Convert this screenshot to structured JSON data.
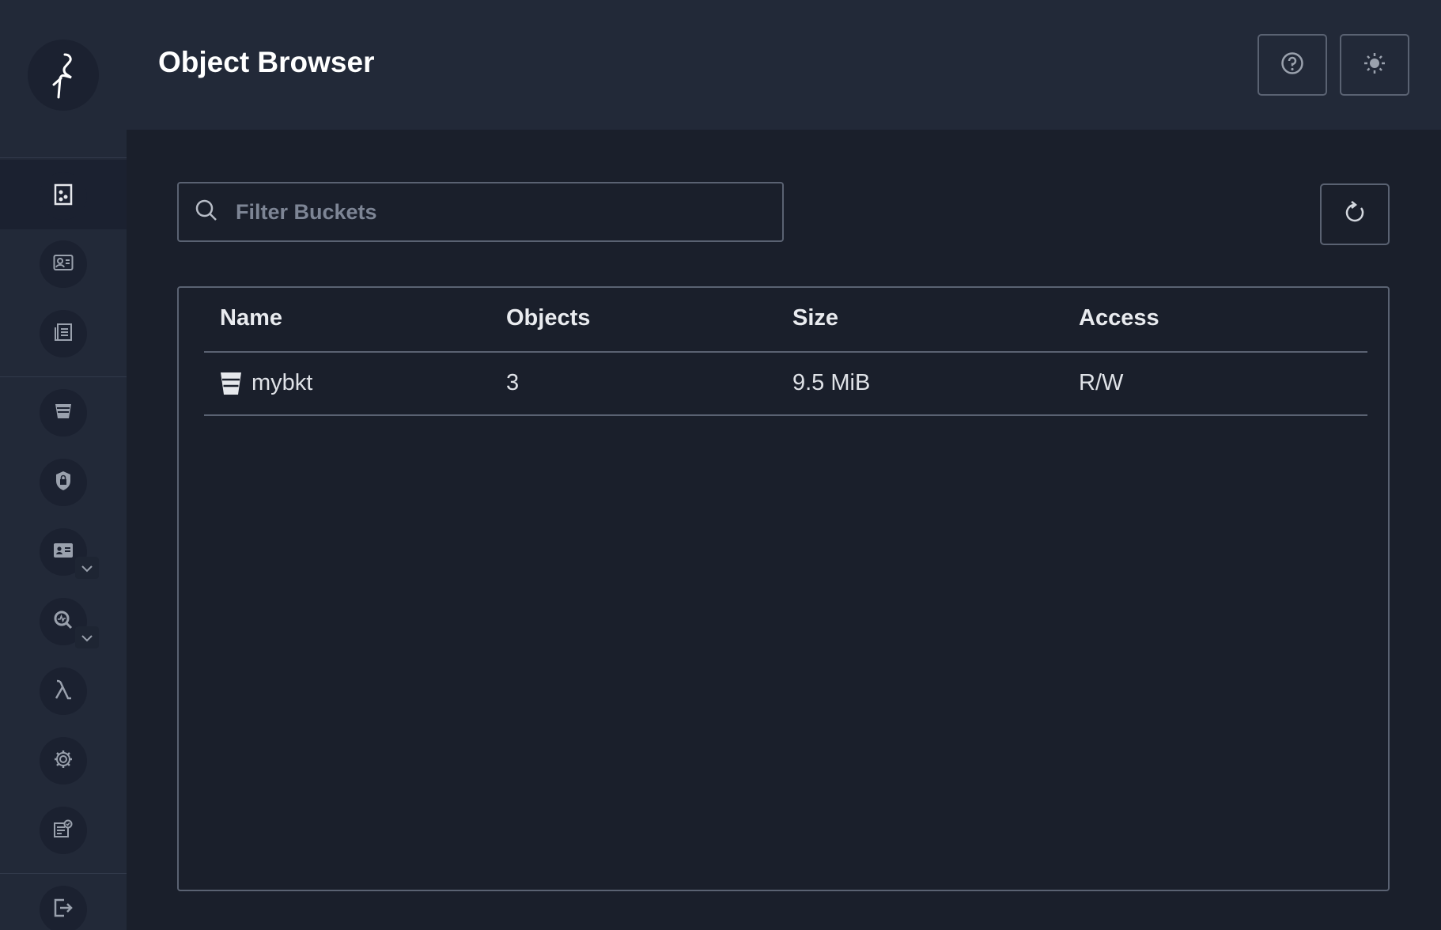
{
  "header": {
    "title": "Object Browser",
    "help_icon": "help-circle-icon",
    "theme_icon": "sun-icon"
  },
  "sidebar": {
    "logo_icon": "minio-bird-logo",
    "items": [
      {
        "icon": "object-browser-icon",
        "active": true
      },
      {
        "icon": "access-keys-icon"
      },
      {
        "icon": "documentation-icon"
      },
      {
        "icon": "buckets-icon"
      },
      {
        "icon": "policies-lock-icon"
      },
      {
        "icon": "identity-card-icon",
        "has_submenu": true
      },
      {
        "icon": "monitoring-icon",
        "has_submenu": true
      },
      {
        "icon": "lambda-icon"
      },
      {
        "icon": "settings-gear-icon"
      },
      {
        "icon": "license-icon"
      },
      {
        "icon": "logout-icon"
      }
    ]
  },
  "search": {
    "placeholder": "Filter Buckets",
    "value": ""
  },
  "table": {
    "columns": [
      "Name",
      "Objects",
      "Size",
      "Access"
    ],
    "rows": [
      {
        "name": "mybkt",
        "objects": "3",
        "size": "9.5 MiB",
        "access": "R/W"
      }
    ]
  },
  "colors": {
    "background": "#1a1f2b",
    "sidebar": "#222938",
    "border": "#5a6272",
    "text": "#e6e8ec"
  }
}
